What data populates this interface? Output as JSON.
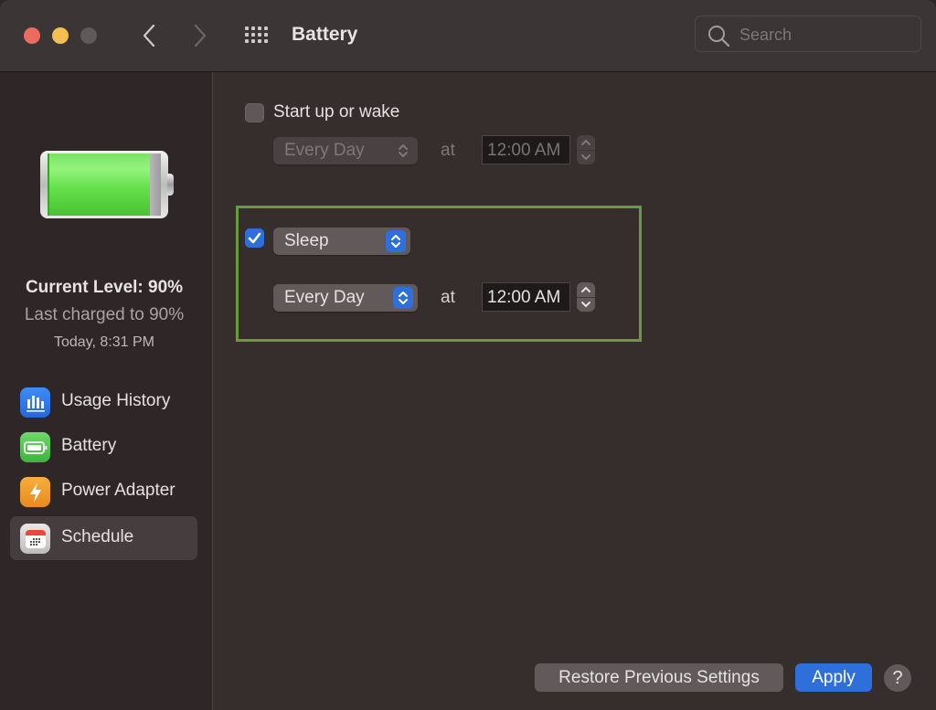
{
  "window": {
    "title": "Battery",
    "search_placeholder": "Search",
    "search_value": ""
  },
  "sidebar": {
    "battery_level_percent": 90,
    "current_level": "Current Level: 90%",
    "last_charged": "Last charged to 90%",
    "last_charged_time": "Today, 8:31 PM",
    "items": [
      {
        "label": "Usage History",
        "icon": "bar-chart-icon",
        "selected": false
      },
      {
        "label": "Battery",
        "icon": "battery-icon",
        "selected": false
      },
      {
        "label": "Power Adapter",
        "icon": "lightning-bolt-icon",
        "selected": false
      },
      {
        "label": "Schedule",
        "icon": "calendar-icon",
        "selected": true
      }
    ]
  },
  "schedule": {
    "startup": {
      "checked": false,
      "label": "Start up or wake",
      "frequency": "Every Day",
      "at_label": "at",
      "time": "12:00 AM"
    },
    "sleep": {
      "checked": true,
      "action": "Sleep",
      "frequency": "Every Day",
      "at_label": "at",
      "time": "12:00 AM"
    }
  },
  "footer": {
    "restore_label": "Restore Previous Settings",
    "apply_label": "Apply",
    "help_label": "?"
  },
  "colors": {
    "accent": "#2f6fdb",
    "highlight_border": "#6a9a3e",
    "battery_fill": "#66e04c"
  }
}
